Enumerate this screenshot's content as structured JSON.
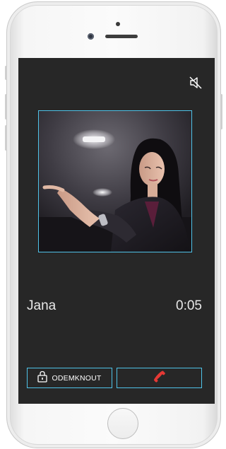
{
  "call": {
    "caller_name": "Jana",
    "duration": "0:05"
  },
  "actions": {
    "unlock_label": "ODEMKNOUT",
    "unlock_icon": "lock-icon",
    "hangup_icon": "phone-hangup-icon"
  },
  "header": {
    "mute_icon": "speaker-muted-icon"
  },
  "colors": {
    "screen_bg": "#272727",
    "accent_border": "#4fc3e8",
    "hangup_red": "#e53935",
    "text": "#e8e8e8"
  }
}
